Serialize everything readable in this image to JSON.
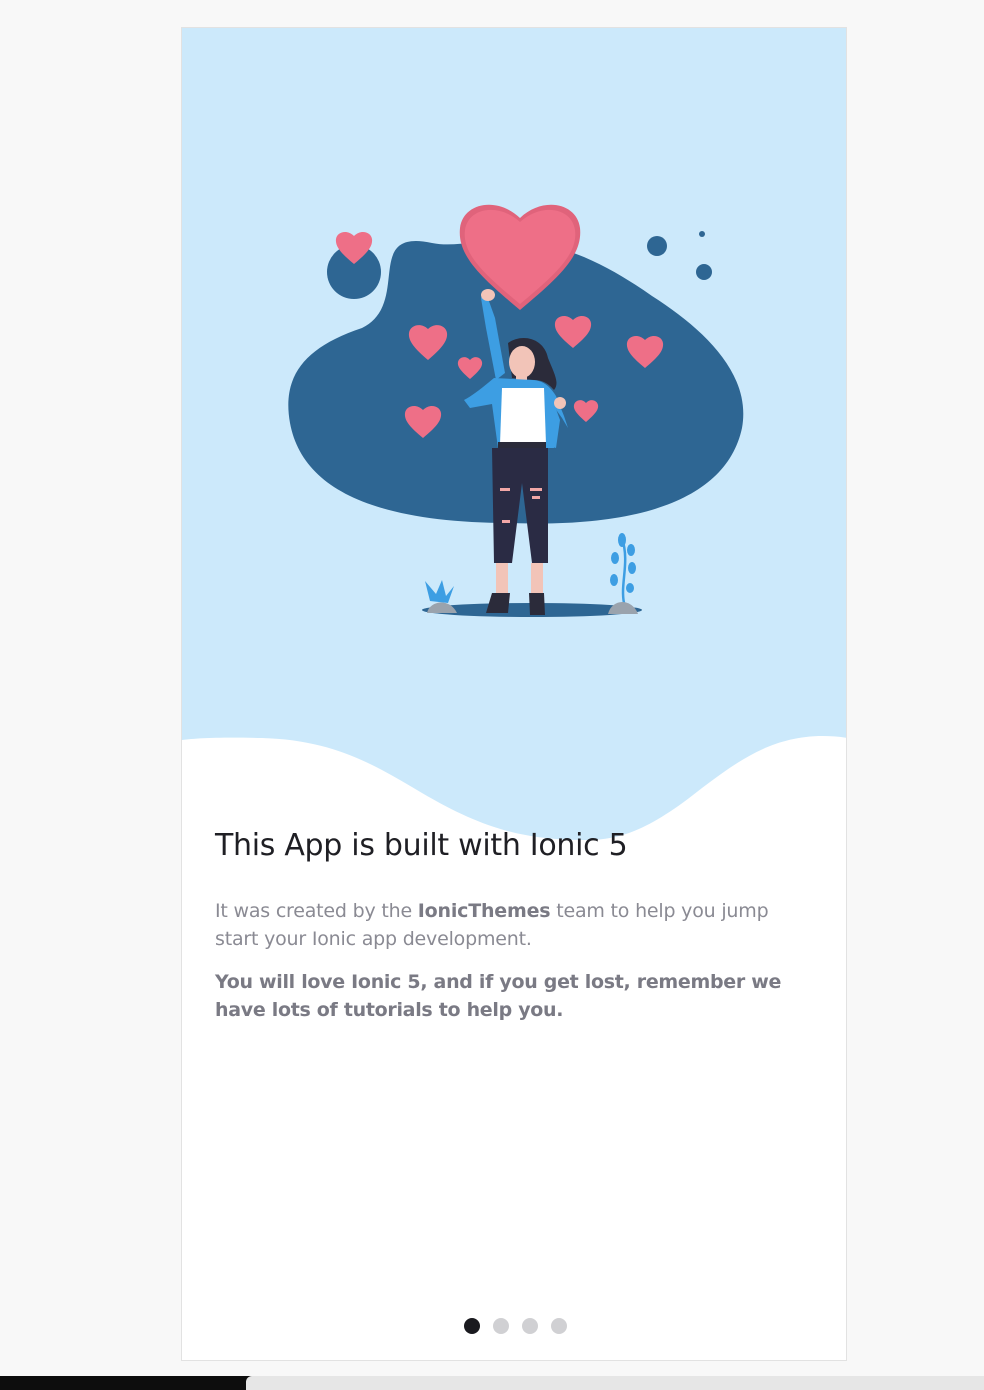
{
  "slide": {
    "title": "This App is built with Ionic 5",
    "para1_prefix": "It was created by the ",
    "para1_bold": "IonicThemes",
    "para1_suffix": " team to help you jump start your Ionic app development.",
    "para2": "You will love Ionic 5, and if you get lost, remember we have lots of tutorials to help you."
  },
  "pager": {
    "total": 4,
    "active_index": 0
  },
  "colors": {
    "hero_background": "#cce9fb",
    "blob": "#2e6693",
    "heart": "#ee6f87",
    "jacket": "#3d9ee3",
    "title_text": "#1f1f24",
    "body_text": "#8a8a93",
    "dot_active": "#1a1a1f",
    "dot_inactive": "#d0d0d3"
  },
  "illustration": {
    "icon": "woman-with-hearts-illustration"
  }
}
